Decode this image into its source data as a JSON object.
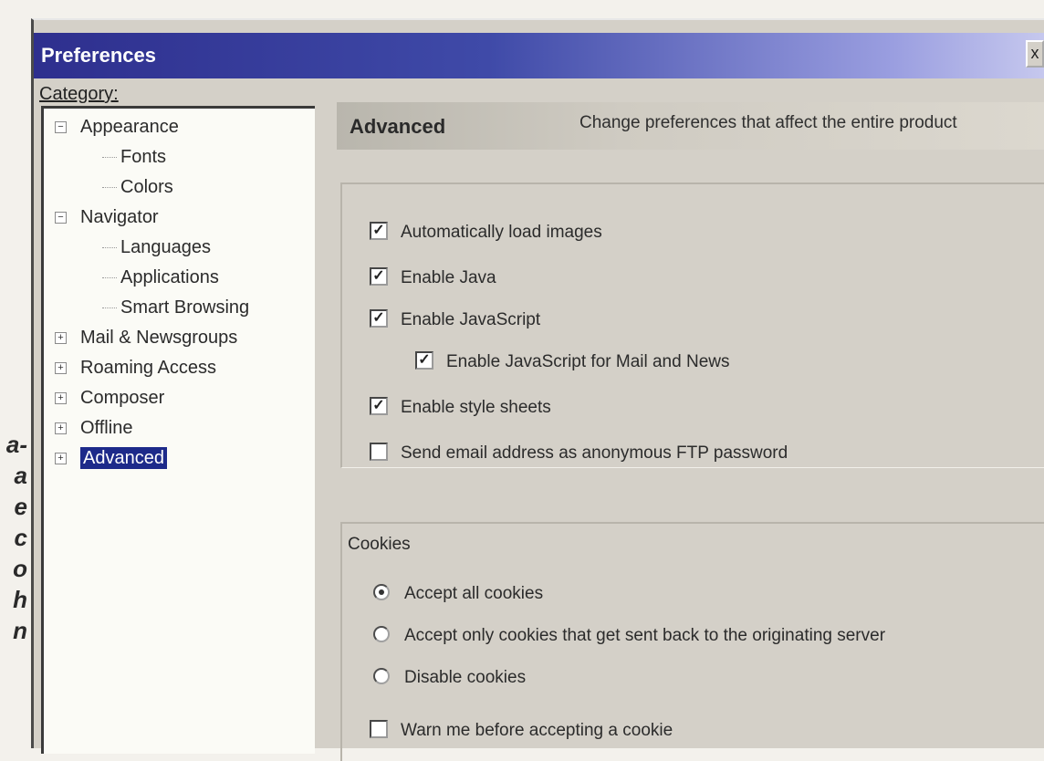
{
  "margin_text": [
    "a-",
    "a",
    "e",
    "c",
    "o",
    "h",
    "n"
  ],
  "window": {
    "title": "Preferences",
    "close_label": "x"
  },
  "category": {
    "label": "Category:",
    "items": [
      {
        "label": "Appearance",
        "level": 0,
        "expander": "−"
      },
      {
        "label": "Fonts",
        "level": 1
      },
      {
        "label": "Colors",
        "level": 1
      },
      {
        "label": "Navigator",
        "level": 0,
        "expander": "−"
      },
      {
        "label": "Languages",
        "level": 1
      },
      {
        "label": "Applications",
        "level": 1
      },
      {
        "label": "Smart Browsing",
        "level": 1
      },
      {
        "label": "Mail & Newsgroups",
        "level": 0,
        "expander": "+"
      },
      {
        "label": "Roaming Access",
        "level": 0,
        "expander": "+"
      },
      {
        "label": "Composer",
        "level": 0,
        "expander": "+"
      },
      {
        "label": "Offline",
        "level": 0,
        "expander": "+"
      },
      {
        "label": "Advanced",
        "level": 0,
        "expander": "+",
        "selected": true
      }
    ]
  },
  "panel": {
    "title": "Advanced",
    "description": "Change preferences that affect the entire product"
  },
  "options": [
    {
      "label": "Automatically load images",
      "checked": true
    },
    {
      "label": "Enable Java",
      "checked": true
    },
    {
      "label": "Enable JavaScript",
      "checked": true
    },
    {
      "label": "Enable JavaScript for Mail and News",
      "checked": true
    },
    {
      "label": "Enable style sheets",
      "checked": true
    },
    {
      "label": "Send email address as anonymous FTP password",
      "checked": false
    }
  ],
  "cookies": {
    "label": "Cookies",
    "radios": [
      {
        "label": "Accept all cookies",
        "selected": true
      },
      {
        "label": "Accept only cookies that get sent back to the originating server",
        "selected": false
      },
      {
        "label": "Disable cookies",
        "selected": false
      }
    ],
    "warn": {
      "label": "Warn me before accepting a cookie",
      "checked": false
    }
  }
}
